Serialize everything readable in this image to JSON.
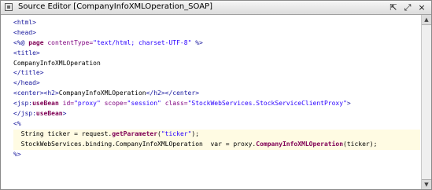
{
  "window": {
    "title": "Source Editor [CompanyInfoXMLOperation_SOAP]",
    "buttons": [
      {
        "name": "restore",
        "glyph": "⇱"
      },
      {
        "name": "maximize",
        "glyph": "⤢"
      },
      {
        "name": "close",
        "glyph": "×"
      }
    ]
  },
  "code_lines": [
    [
      {
        "t": "<html>",
        "c": "tag"
      }
    ],
    [
      {
        "t": "<head>",
        "c": "tag"
      }
    ],
    [
      {
        "t": "<%@ ",
        "c": "tag"
      },
      {
        "t": "page",
        "c": "kw"
      },
      {
        "t": " contentType=",
        "c": "attr"
      },
      {
        "t": "\"text/html; charset-UTF-8\"",
        "c": "str"
      },
      {
        "t": " %>",
        "c": "tag"
      }
    ],
    [
      {
        "t": "<title>",
        "c": "tag"
      }
    ],
    [
      {
        "t": "CompanyInfoXMLOperation",
        "c": "txt"
      }
    ],
    [
      {
        "t": "</title>",
        "c": "tag"
      }
    ],
    [
      {
        "t": "</head>",
        "c": "tag"
      }
    ],
    [
      {
        "t": "<center><h2>",
        "c": "tag"
      },
      {
        "t": "CompanyInfoXMLOperation",
        "c": "txt"
      },
      {
        "t": "</h2></center>",
        "c": "tag"
      }
    ],
    [
      {
        "t": "<jsp:",
        "c": "tag"
      },
      {
        "t": "useBean",
        "c": "kw"
      },
      {
        "t": " id=",
        "c": "attr"
      },
      {
        "t": "\"proxy\"",
        "c": "str"
      },
      {
        "t": " scope=",
        "c": "attr"
      },
      {
        "t": "\"session\"",
        "c": "str"
      },
      {
        "t": " class=",
        "c": "attr"
      },
      {
        "t": "\"StockWebServices.StockServiceClientProxy\"",
        "c": "str"
      },
      {
        "t": ">",
        "c": "tag"
      }
    ],
    [
      {
        "t": "</jsp:",
        "c": "tag"
      },
      {
        "t": "useBean",
        "c": "kw"
      },
      {
        "t": ">",
        "c": "tag"
      }
    ],
    [
      {
        "t": "<%",
        "c": "tag"
      }
    ],
    [
      {
        "t": "  String ticker = request.",
        "c": "txt"
      },
      {
        "t": "getParameter",
        "c": "kw"
      },
      {
        "t": "(",
        "c": "txt"
      },
      {
        "t": "\"ticker\"",
        "c": "str"
      },
      {
        "t": ");",
        "c": "txt"
      }
    ],
    [
      {
        "t": "  StockWebServices.binding.CompanyInfoXMLOperation  var = proxy.",
        "c": "txt"
      },
      {
        "t": "CompanyInfoXMLOperation",
        "c": "kw"
      },
      {
        "t": "(ticker);",
        "c": "txt"
      }
    ],
    [
      {
        "t": "%>",
        "c": "tag"
      }
    ]
  ],
  "colors": {
    "tag": "#1a1a9e",
    "keyword": "#7f0055",
    "attribute": "#7f007f",
    "string": "#2a00ff",
    "highlight": "#fffbe3"
  }
}
